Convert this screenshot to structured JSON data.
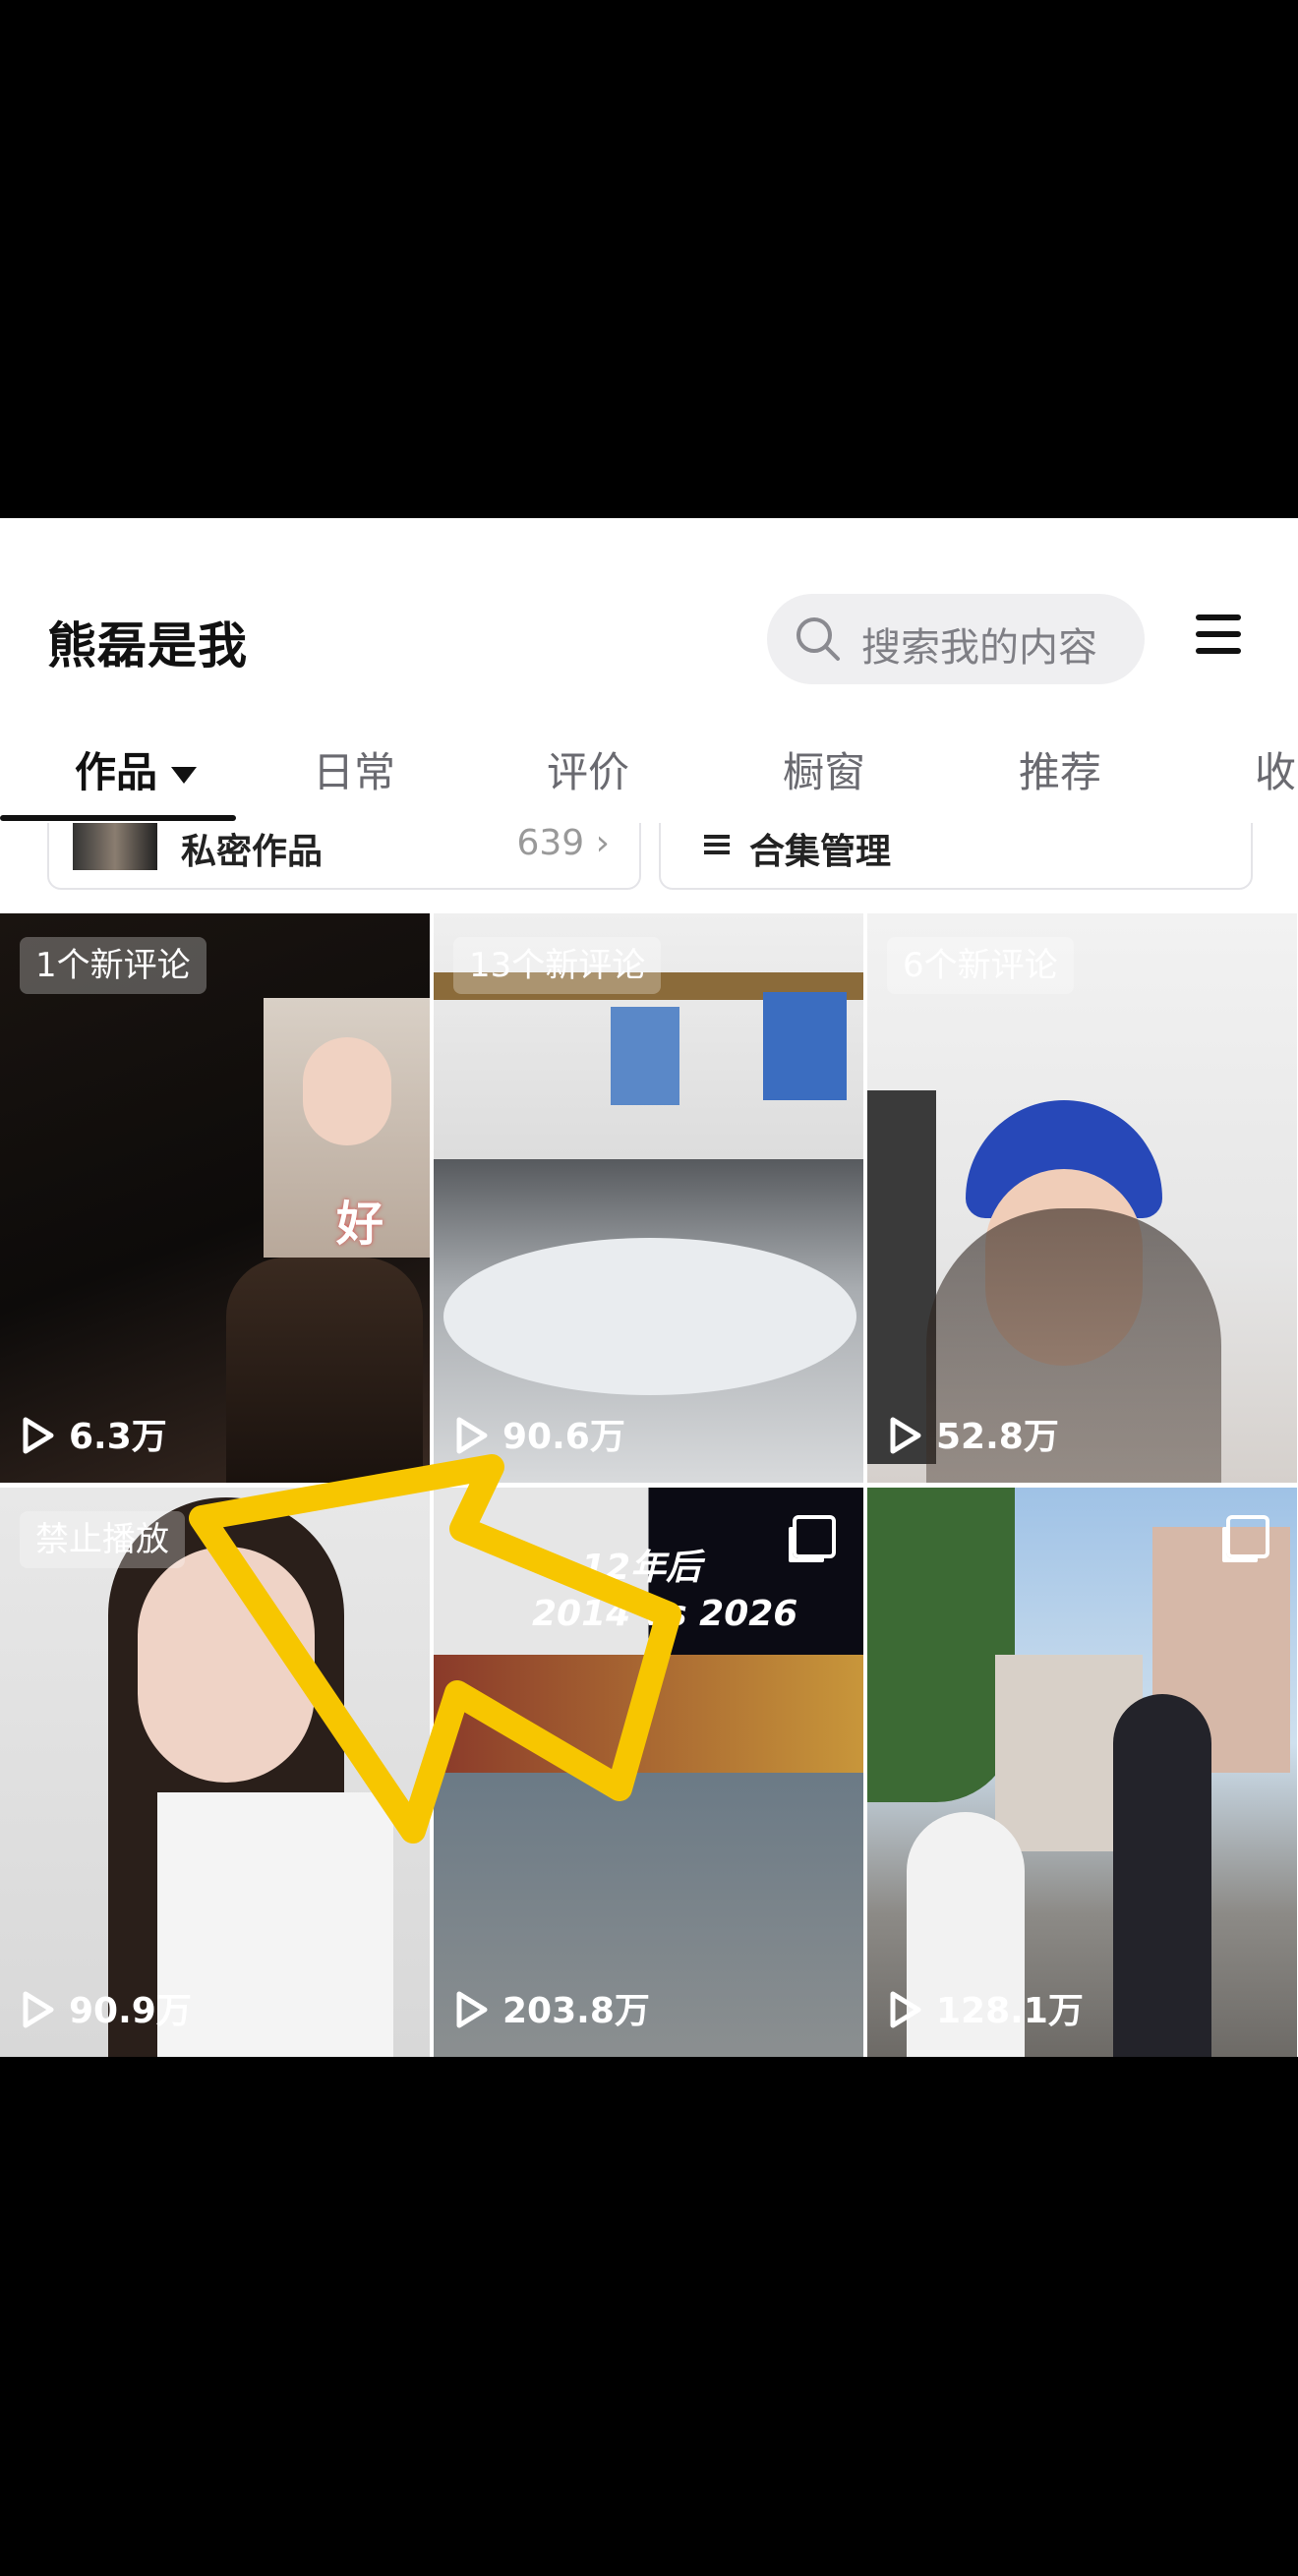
{
  "profile": {
    "title": "熊磊是我"
  },
  "search": {
    "placeholder": "搜索我的内容"
  },
  "tabs": [
    {
      "label": "作品"
    },
    {
      "label": "日常"
    },
    {
      "label": "评价"
    },
    {
      "label": "橱窗"
    },
    {
      "label": "推荐"
    },
    {
      "label": "收"
    }
  ],
  "cards": {
    "private_label": "私密作品",
    "private_count": "639 ›",
    "collection_label": "合集管理"
  },
  "videos": [
    {
      "badge": "1个新评论",
      "views": "6.3万",
      "overlay_text": "好看"
    },
    {
      "badge": "13个新评论",
      "views": "90.6万"
    },
    {
      "badge": "6个新评论",
      "views": "52.8万"
    },
    {
      "badge": "禁止播放",
      "views": "90.9万"
    },
    {
      "views": "203.8万",
      "overlay_line1": "12年后",
      "overlay_line2": "2014 vs 2026"
    },
    {
      "views": "128.1万"
    }
  ],
  "colors": {
    "accent_arrow": "#F7C600",
    "panel_bg": "#FFFFFF",
    "screen_bg": "#000000"
  }
}
